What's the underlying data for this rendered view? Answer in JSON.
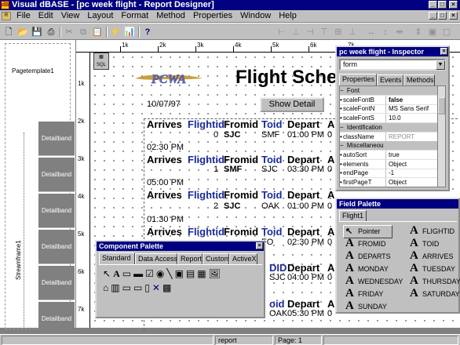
{
  "window": {
    "title": "Visual dBASE - [pc week flight - Report Designer]",
    "min": "_",
    "max": "□",
    "close": "×"
  },
  "menu": [
    "File",
    "Edit",
    "View",
    "Layout",
    "Format",
    "Method",
    "Properties",
    "Window",
    "Help"
  ],
  "ruler": {
    "h": [
      "1k",
      "2k",
      "3k",
      "4k",
      "5k",
      "6k",
      "7k"
    ],
    "v": [
      "1k",
      "2k",
      "3k",
      "4k",
      "5k",
      "6k",
      "7k"
    ]
  },
  "left_pane": {
    "page_template": "Pagetemplate1",
    "stream_frame": "Streamframe1",
    "detailband": "Detailband"
  },
  "report": {
    "title": "Flight Sche",
    "date": "10/07/97",
    "show_detail": "Show Detail",
    "headers": [
      "Arrives",
      "Flightid",
      "Fromid",
      "Toid",
      "Depart",
      "A"
    ],
    "rows": [
      {
        "time": "",
        "flightid": "0",
        "fromid": "SJC",
        "toid": "SMF",
        "depart": "01:00 PM",
        "a": "0"
      },
      {
        "time": "02:30 PM",
        "flightid": "1",
        "fromid": "SMF",
        "toid": "SJC",
        "depart": "03:30 PM",
        "a": "0"
      },
      {
        "time": "05:00 PM",
        "flightid": "2",
        "fromid": "SJC",
        "toid": "OAK",
        "depart": "01:00 PM",
        "a": "0"
      },
      {
        "time": "01:30 PM",
        "flightid": "",
        "fromid": "",
        "toid": "FO",
        "depart": "02:30 PM",
        "a": "0"
      }
    ],
    "extra": [
      {
        "toid": "DID",
        "depart": "Depart",
        "a": "A"
      },
      {
        "toid": "SJC",
        "depart": "04:00 PM",
        "a": "0"
      },
      {
        "toid": "oid",
        "depart": "Depart",
        "a": "A"
      },
      {
        "toid": "OAK",
        "depart": "05:30 PM",
        "a": "0"
      }
    ]
  },
  "inspector": {
    "title": "pc week flight - Inspector",
    "object": "form",
    "tabs": [
      "Properties",
      "Events",
      "Methods"
    ],
    "rows": [
      {
        "type": "group",
        "name": "Font"
      },
      {
        "name": "scaleFontB",
        "value": "false",
        "bold": true
      },
      {
        "name": "scaleFontN",
        "value": "MS Sans Serif"
      },
      {
        "name": "scaleFontS",
        "value": "10.0"
      },
      {
        "type": "group",
        "name": "Identification"
      },
      {
        "name": "className",
        "value": "REPORT",
        "gray": true
      },
      {
        "type": "group",
        "name": "Miscellaneou"
      },
      {
        "name": "autoSort",
        "value": "true"
      },
      {
        "name": "elements",
        "value": "Object"
      },
      {
        "name": "endPage",
        "value": "-1"
      },
      {
        "name": "firstPageT",
        "value": "Object"
      }
    ]
  },
  "field_palette": {
    "title": "Field Palette",
    "tab": "Flight1",
    "items": [
      "Pointer",
      "FLIGHTID",
      "FROMID",
      "TOID",
      "DEPARTS",
      "ARRIVES",
      "MONDAY",
      "TUESDAY",
      "WEDNESDAY",
      "THURSDAY",
      "FRIDAY",
      "SATURDAY",
      "SUNDAY"
    ]
  },
  "component_palette": {
    "title": "Component Palette",
    "tabs": [
      "Standard",
      "Data Access",
      "Report",
      "Custom",
      "ActiveX"
    ]
  },
  "status": {
    "mode": "report",
    "page": "Page: 1"
  },
  "colors": {
    "title_bg": "#000080",
    "face": "#c0c0c0",
    "band": "#808080",
    "field_blue": "#1a2a9a"
  }
}
